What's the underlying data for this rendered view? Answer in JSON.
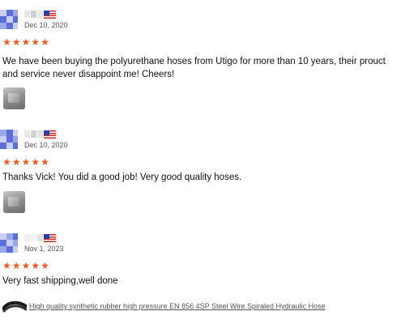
{
  "reviews": [
    {
      "date": "Dec 10, 2020",
      "rating_stars": 5,
      "text": "We have been buying the polyurethane hoses from Utigo for more than 10 years, their prouct and service never disappoint me! Cheers!",
      "has_photo": true
    },
    {
      "date": "Dec 10, 2020",
      "rating_stars": 5,
      "text": "Thanks Vick! You did a good job! Very good quality hoses.",
      "has_photo": true
    },
    {
      "date": "Nov 1, 2023",
      "rating_stars": 5,
      "text": "Very fast shipping,well done",
      "has_photo": false
    }
  ],
  "product_link": {
    "label": "High quality synthetic rubber high pressure EN 856 4SP Steel Wire Spiraled Hydraulic Hose"
  },
  "colors": {
    "star": "#f05a22",
    "avatar_blue": "#5b6fd6",
    "avatar_light": "#c9cff0",
    "link": "#555555"
  },
  "icons": {
    "country_flag": "us-flag-icon",
    "rating": "star-icon",
    "product": "hydraulic-hose-icon"
  }
}
